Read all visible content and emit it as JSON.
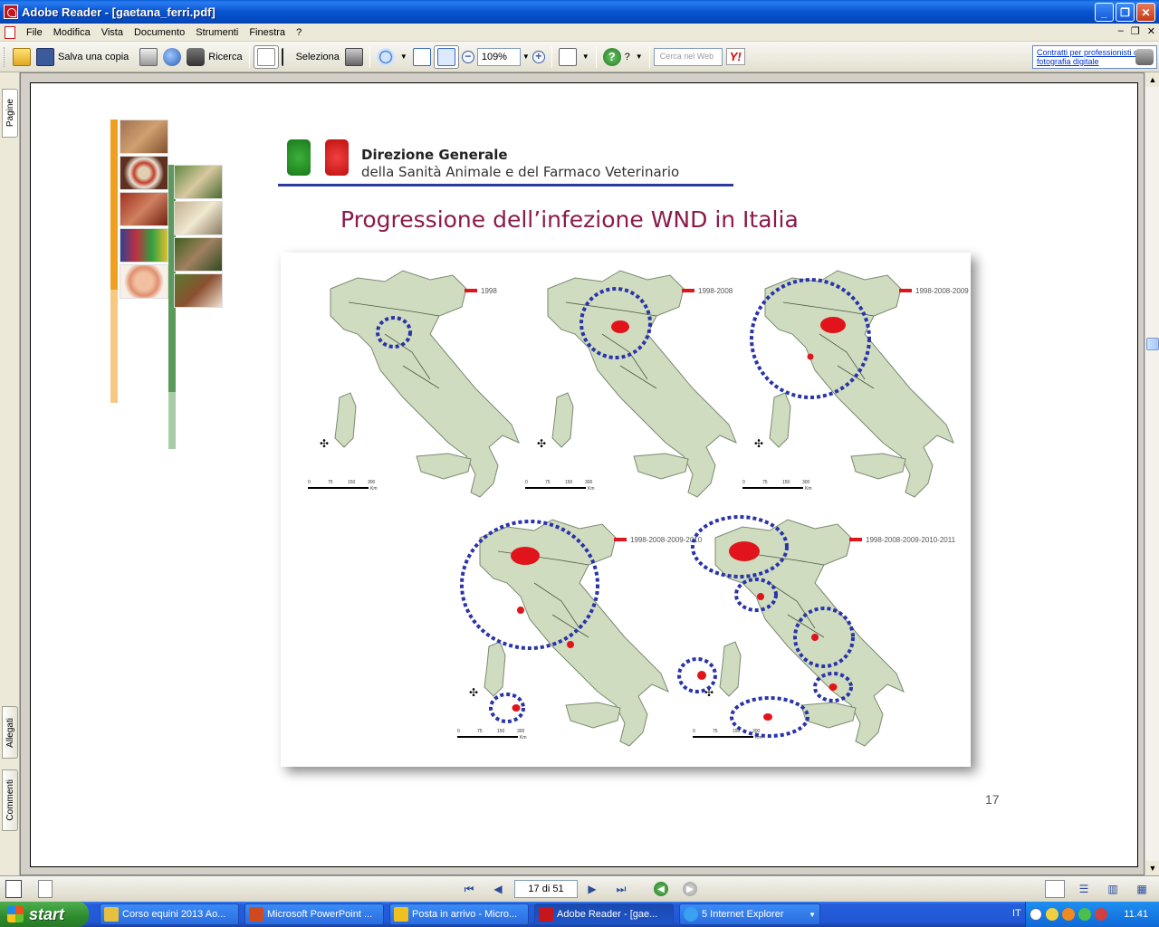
{
  "window": {
    "title": "Adobe Reader - [gaetana_ferri.pdf]"
  },
  "menu": [
    "File",
    "Modifica",
    "Vista",
    "Documento",
    "Strumenti",
    "Finestra",
    "?"
  ],
  "toolbar": {
    "save_copy": "Salva una copia",
    "search": "Ricerca",
    "select": "Seleziona",
    "zoom": "109%",
    "help": "?",
    "web_search_placeholder": "Cerca nel Web",
    "yahoo": "Y!",
    "ad_text": "Contratti per professionisti di fotografia digitale"
  },
  "side_tabs": {
    "pages": "Pagine",
    "attachments": "Allegati",
    "comments": "Commenti"
  },
  "slide": {
    "org_title": "Direzione Generale",
    "org_subtitle": "della Sanità Animale e del Farmaco Veterinario",
    "title": "Progressione dell’infezione WND in Italia",
    "page_number": "17",
    "maps": [
      {
        "legend": "1998",
        "circles": 1
      },
      {
        "legend": "1998-2008",
        "circles": 1
      },
      {
        "legend": "1998-2008-2009",
        "circles": 1
      },
      {
        "legend": "1998-2008-2009-2010",
        "circles": 2
      },
      {
        "legend": "1998-2008-2009-2010-2011",
        "circles": 6
      }
    ],
    "scale_labels": [
      "0",
      "75",
      "150",
      "300"
    ],
    "scale_unit": "Km"
  },
  "navigation": {
    "page_indicator": "17 di 51"
  },
  "taskbar": {
    "start": "start",
    "tasks": [
      "Corso equini 2013 Ao...",
      "Microsoft PowerPoint ...",
      "Posta in arrivo - Micro...",
      "Adobe Reader - [gae...",
      "5 Internet Explorer"
    ],
    "language": "IT",
    "clock": "11.41"
  },
  "colors": {
    "accent_title": "#8a1a4a",
    "circle_dotted": "#2a34a8",
    "infection_red": "#e0141a",
    "map_land": "#cfdcc0"
  }
}
